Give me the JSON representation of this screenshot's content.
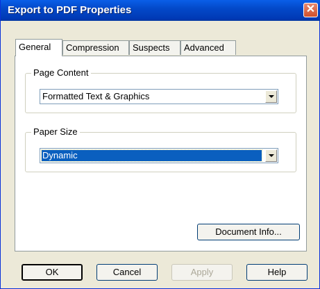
{
  "window": {
    "title": "Export to PDF Properties",
    "close_glyph": "✕"
  },
  "tabs": [
    {
      "label": "General",
      "active": true
    },
    {
      "label": "Compression",
      "active": false
    },
    {
      "label": "Suspects",
      "active": false
    },
    {
      "label": "Advanced",
      "active": false
    }
  ],
  "page_content": {
    "legend": "Page Content",
    "value": "Formatted Text & Graphics"
  },
  "paper_size": {
    "legend": "Paper Size",
    "value": "Dynamic"
  },
  "document_info_button": "Document Info...",
  "footer": {
    "ok": "OK",
    "cancel": "Cancel",
    "apply": "Apply",
    "help": "Help"
  },
  "colors": {
    "title_bar": "#0349c9",
    "selection": "#0a5fbf",
    "dialog_bg": "#ece9d8"
  }
}
